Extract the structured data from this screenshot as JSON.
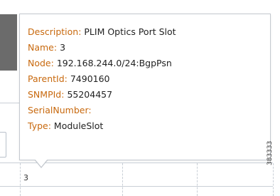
{
  "tooltip": {
    "lines": [
      {
        "key": "Description:",
        "value": "PLIM Optics Port Slot"
      },
      {
        "key": "Name:",
        "value": "3"
      },
      {
        "key": "Node:",
        "value": "192.168.244.0/24:BgpPsn"
      },
      {
        "key": "ParentId:",
        "value": "7490160"
      },
      {
        "key": "SNMPId:",
        "value": "55204457"
      },
      {
        "key": "SerialNumber:",
        "value": ""
      },
      {
        "key": "Type:",
        "value": "ModuleSlot"
      }
    ]
  },
  "table": {
    "cell_value": "3"
  },
  "figure_id": "383333",
  "colors": {
    "key": "#c8690e",
    "value": "#222222",
    "border": "#c4c9cf"
  }
}
